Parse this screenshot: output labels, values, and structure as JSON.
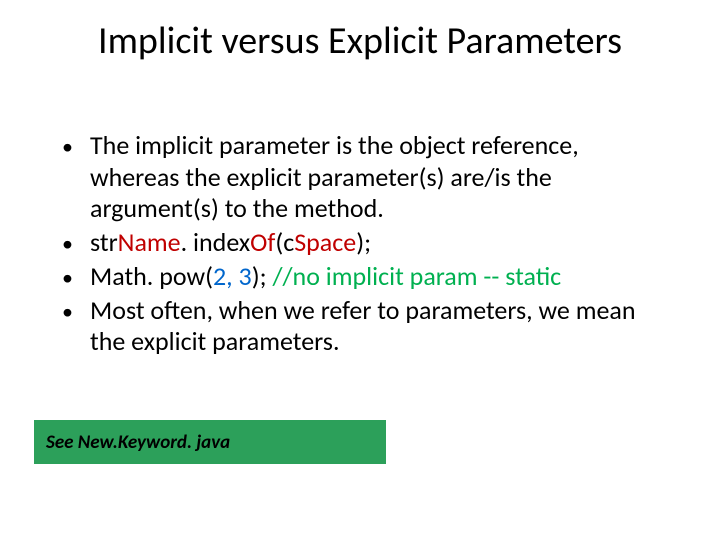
{
  "title": "Implicit versus Explicit Parameters",
  "bullets": {
    "b1": "The implicit parameter is the object reference, whereas the explicit parameter(s) are/is the argument(s) to the method.",
    "b2": {
      "p1": "str",
      "p2": "Name",
      "p3": ". index",
      "p4": "Of",
      "p5": "(c",
      "p6": "Space",
      "p7": ");"
    },
    "b3": {
      "p1": "Math. pow(",
      "p2": "2, 3",
      "p3": "); ",
      "p4": " //no implicit param -- static"
    },
    "b4": "Most often, when we refer to parameters, we mean the explicit parameters."
  },
  "callout": "See New.Keyword. java"
}
